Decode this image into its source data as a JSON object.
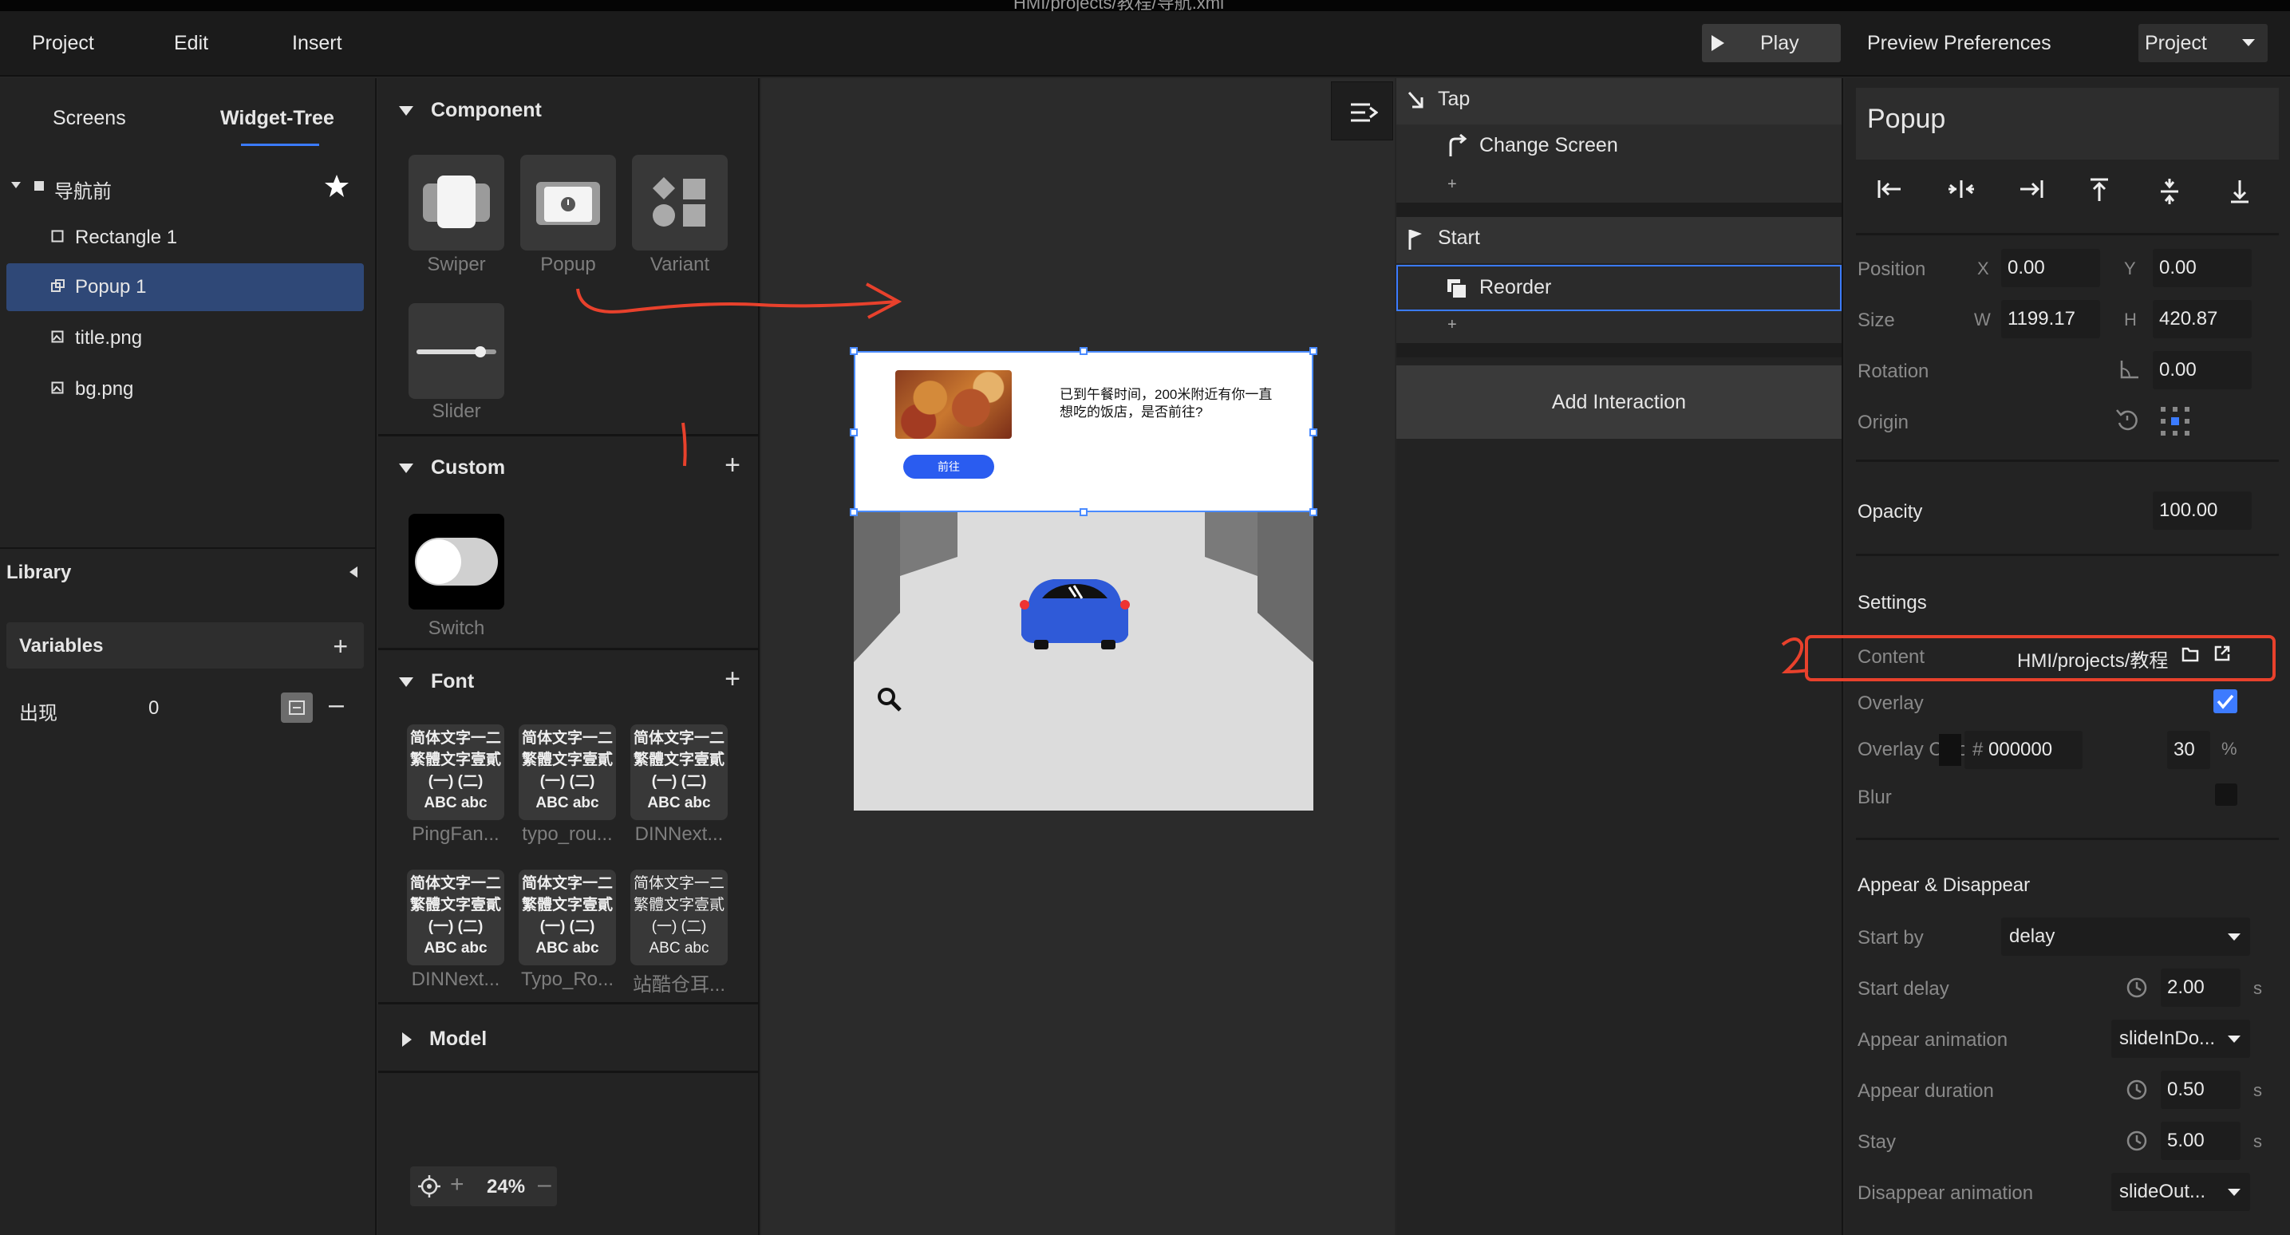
{
  "window": {
    "title": "HMI/projects/教程/导航.xml"
  },
  "menu": {
    "items": [
      "Project",
      "Edit",
      "Insert"
    ],
    "play": "Play",
    "preview_preferences": "Preview Preferences",
    "project_select": "Project"
  },
  "left_panel": {
    "tabs": [
      "Screens",
      "Widget-Tree"
    ],
    "active_tab": "Widget-Tree",
    "tree": [
      {
        "label": "导航前",
        "icon": "screen-icon"
      },
      {
        "label": "Rectangle 1",
        "icon": "rectangle-icon"
      },
      {
        "label": "Popup 1",
        "icon": "popup-icon",
        "selected": true
      },
      {
        "label": "title.png",
        "icon": "image-icon"
      },
      {
        "label": "bg.png",
        "icon": "image-icon"
      }
    ],
    "library": "Library",
    "variables": "Variables",
    "variable": {
      "name": "出现",
      "value": "0"
    }
  },
  "component_panel": {
    "sections": {
      "component": "Component",
      "custom": "Custom",
      "font": "Font",
      "model": "Model"
    },
    "components": [
      "Swiper",
      "Popup",
      "Variant",
      "Slider"
    ],
    "custom": [
      "Switch"
    ],
    "font_sample": {
      "line1": "简体文字一二",
      "line2": "繁體文字壹貳",
      "line3": "(一)  (二)",
      "line4": "ABC abc"
    },
    "fonts": [
      "PingFan...",
      "typo_rou...",
      "DINNext...",
      "DINNext...",
      "Typo_Ro...",
      "站酷仓耳..."
    ],
    "zoom": "24%"
  },
  "canvas": {
    "popup_text": "已到午餐时间，200米附近有你一直想吃的饭店，是否前往?",
    "popup_button": "前往",
    "annotation_1": "1",
    "annotation_2": "2"
  },
  "interaction_panel": {
    "trigger1": "Tap",
    "action1": "Change Screen",
    "trigger2": "Start",
    "action2": "Reorder",
    "add_interaction": "Add Interaction"
  },
  "properties": {
    "title": "Popup",
    "position": {
      "label": "Position",
      "x": "0.00",
      "y": "0.00"
    },
    "size": {
      "label": "Size",
      "w": "1199.17",
      "h": "420.87"
    },
    "rotation": {
      "label": "Rotation",
      "value": "0.00"
    },
    "origin": {
      "label": "Origin"
    },
    "opacity": {
      "label": "Opacity",
      "value": "100.00"
    },
    "settings": "Settings",
    "content": {
      "label": "Content",
      "value": "HMI/projects/教程"
    },
    "overlay": {
      "label": "Overlay",
      "checked": true
    },
    "overlay_colour": {
      "label": "Overlay Colour",
      "hex": "000000",
      "opacity": "30",
      "unit": "%"
    },
    "blur": {
      "label": "Blur"
    },
    "appear_disappear": "Appear & Disappear",
    "start_by": {
      "label": "Start by",
      "value": "delay"
    },
    "start_delay": {
      "label": "Start delay",
      "value": "2.00",
      "unit": "s"
    },
    "appear_animation": {
      "label": "Appear animation",
      "value": "slideInDo..."
    },
    "appear_duration": {
      "label": "Appear duration",
      "value": "0.50",
      "unit": "s"
    },
    "stay": {
      "label": "Stay",
      "value": "5.00",
      "unit": "s"
    },
    "disappear_animation": {
      "label": "Disappear animation",
      "value": "slideOut..."
    },
    "axis": {
      "x": "X",
      "y": "Y",
      "w": "W",
      "h": "H"
    }
  },
  "colors": {
    "accent": "#3b7bff",
    "selection": "#2f4877",
    "annotation": "#e8412c"
  }
}
